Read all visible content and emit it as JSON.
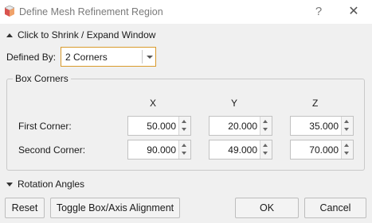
{
  "window": {
    "title": "Define Mesh Refinement Region",
    "help_label": "?",
    "close_label": "✕",
    "app_icon": "cube-icon"
  },
  "collapse": {
    "label": "Click to Shrink / Expand Window",
    "expanded": true
  },
  "defined_by": {
    "label": "Defined By:",
    "value": "2 Corners"
  },
  "box_corners": {
    "title": "Box Corners",
    "columns": [
      "X",
      "Y",
      "Z"
    ],
    "rows": [
      {
        "label": "First Corner:",
        "values": [
          "50.000",
          "20.000",
          "35.000"
        ]
      },
      {
        "label": "Second Corner:",
        "values": [
          "90.000",
          "49.000",
          "70.000"
        ]
      }
    ]
  },
  "rotation": {
    "label": "Rotation Angles",
    "expanded": false
  },
  "buttons": {
    "reset": "Reset",
    "toggle": "Toggle Box/Axis Alignment",
    "ok": "OK",
    "cancel": "Cancel"
  },
  "colors": {
    "accent_border": "#d99a2b",
    "icon_red": "#d9534f"
  }
}
